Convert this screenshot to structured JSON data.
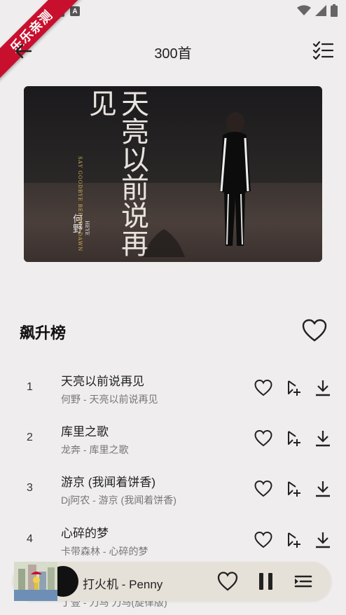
{
  "ribbon": {
    "text": "乐乐亲测"
  },
  "header": {
    "title": "300首"
  },
  "album_art": {
    "title_text": "天亮以前说再见",
    "en_text": "SAY GOODBYE BEFORE DAWN",
    "artist_cn": "何野",
    "artist_en": "HEYE"
  },
  "section": {
    "title": "飙升榜"
  },
  "songs": [
    {
      "num": "1",
      "title": "天亮以前说再见",
      "sub": "何野 - 天亮以前说再见"
    },
    {
      "num": "2",
      "title": "库里之歌",
      "sub": "龙奔 - 库里之歌"
    },
    {
      "num": "3",
      "title": "游京 (我闻着饼香)",
      "sub": "Dj阿农 - 游京 (我闻着饼香)"
    },
    {
      "num": "4",
      "title": "心碎的梦",
      "sub": "卡带森林 - 心碎的梦"
    },
    {
      "num": "",
      "title": "",
      "sub": "丁壹 - 刀马 刀马(旋律版)"
    }
  ],
  "player": {
    "title": "打火机 - Penny"
  },
  "icons": {
    "back": "arrow-left-icon",
    "list": "checklist-icon",
    "heart": "heart-icon",
    "add_to_playlist": "add-to-playlist-icon",
    "download": "download-icon",
    "pause": "pause-icon",
    "queue": "queue-icon"
  }
}
